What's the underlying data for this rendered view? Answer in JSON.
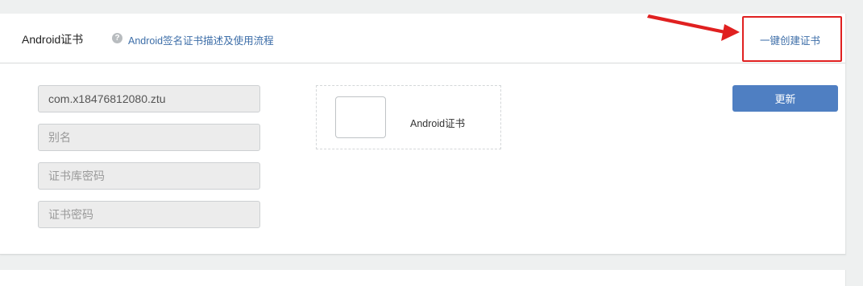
{
  "header": {
    "title": "Android证书",
    "help_icon_glyph": "?",
    "help_link": "Android签名证书描述及使用流程",
    "create_link": "一键创建证书"
  },
  "form": {
    "package_value": "com.x18476812080.ztu",
    "alias_placeholder": "别名",
    "keystore_password_placeholder": "证书库密码",
    "cert_password_placeholder": "证书密码"
  },
  "certificate": {
    "label": "Android证书"
  },
  "actions": {
    "update_label": "更新"
  },
  "colors": {
    "accent": "#4f7fc2",
    "link": "#3d6ea8",
    "annotation_red": "#e02020"
  }
}
